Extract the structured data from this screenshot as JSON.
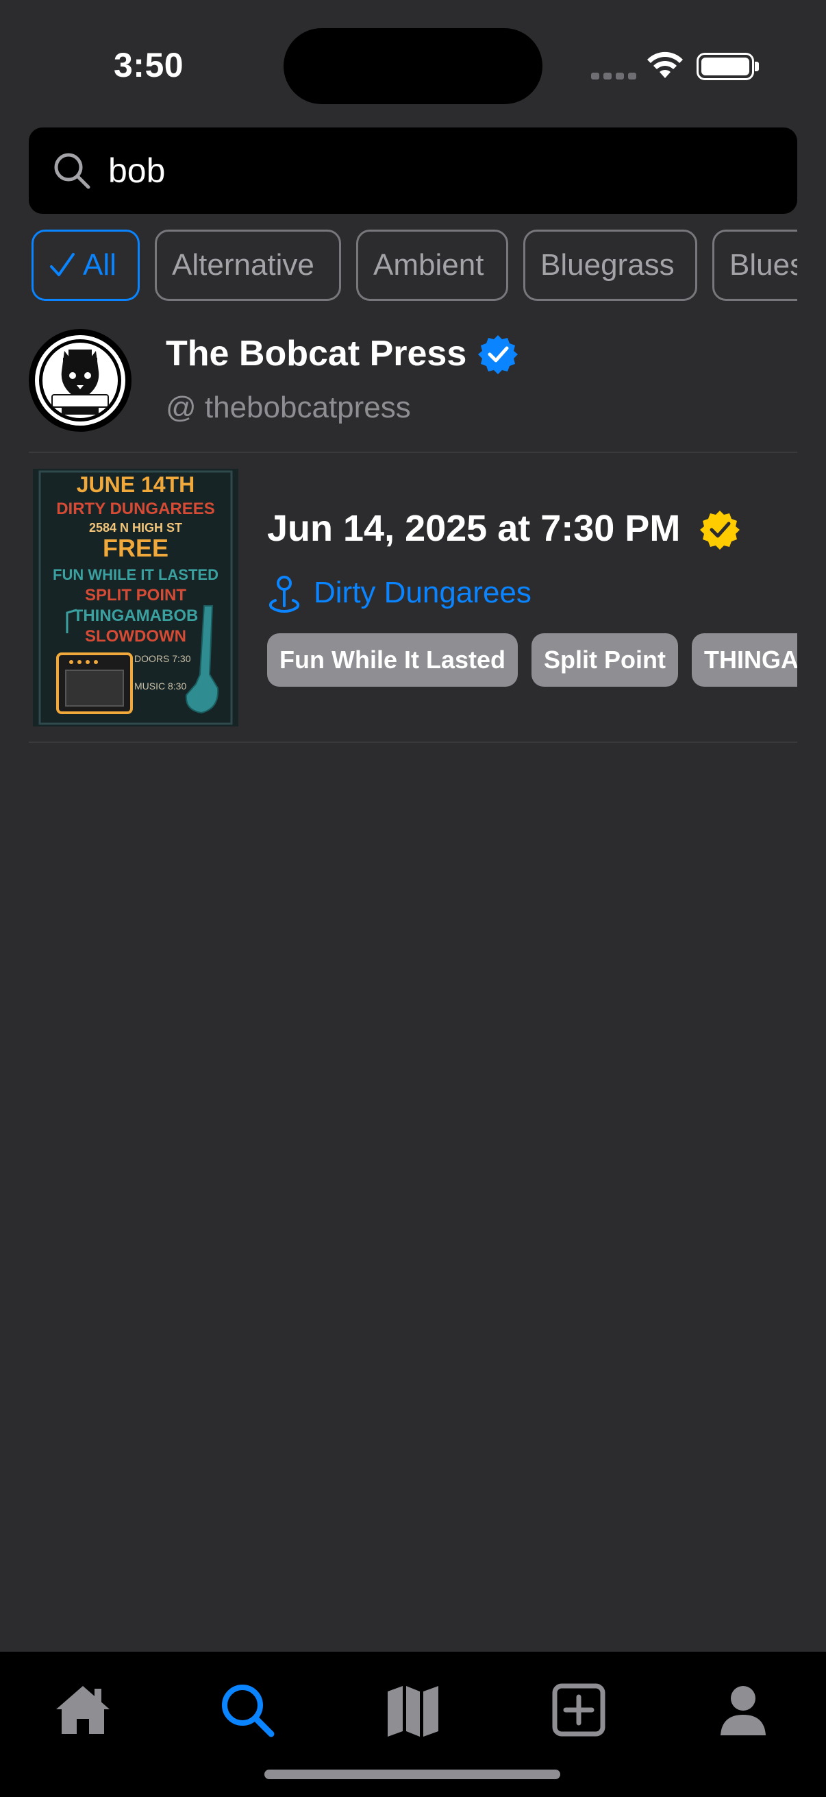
{
  "status_bar": {
    "time": "3:50"
  },
  "search": {
    "value": "bob",
    "icon": "search-icon"
  },
  "genres": [
    {
      "label": "All",
      "selected": true
    },
    {
      "label": "Alternative",
      "selected": false
    },
    {
      "label": "Ambient",
      "selected": false
    },
    {
      "label": "Bluegrass",
      "selected": false
    },
    {
      "label": "Blues",
      "selected": false
    }
  ],
  "account": {
    "name": "The Bobcat Press",
    "handle": "@ thebobcatpress",
    "verified": true,
    "avatar_logo_text": "THE BOBCAT PRESS"
  },
  "event": {
    "date": "Jun 14, 2025 at 7:30 PM",
    "verified": true,
    "venue": "Dirty Dungarees",
    "performers": [
      "Fun While It Lasted",
      "Split Point",
      "THINGAMABOB"
    ],
    "poster": {
      "date": "JUNE 14TH",
      "venue": "DIRTY DUNGAREES",
      "address": "2584 N HIGH ST",
      "price": "FREE",
      "bands": [
        "FUN WHILE IT LASTED",
        "SPLIT POINT",
        "THINGAMABOB",
        "SLOWDOWN"
      ],
      "doors": "DOORS 7:30",
      "music": "MUSIC 8:30"
    }
  },
  "tab_bar": {
    "tabs": [
      {
        "name": "home",
        "icon": "home-icon",
        "active": false
      },
      {
        "name": "search",
        "icon": "search-icon",
        "active": true
      },
      {
        "name": "map",
        "icon": "map-icon",
        "active": false
      },
      {
        "name": "add",
        "icon": "plus-square-icon",
        "active": false
      },
      {
        "name": "profile",
        "icon": "person-icon",
        "active": false
      }
    ]
  },
  "colors": {
    "background": "#2c2c2e",
    "accent": "#0a84ff",
    "verified_gold": "#ffcc00",
    "tag_bg": "#8e8e93",
    "muted_text": "#8e8e93"
  }
}
